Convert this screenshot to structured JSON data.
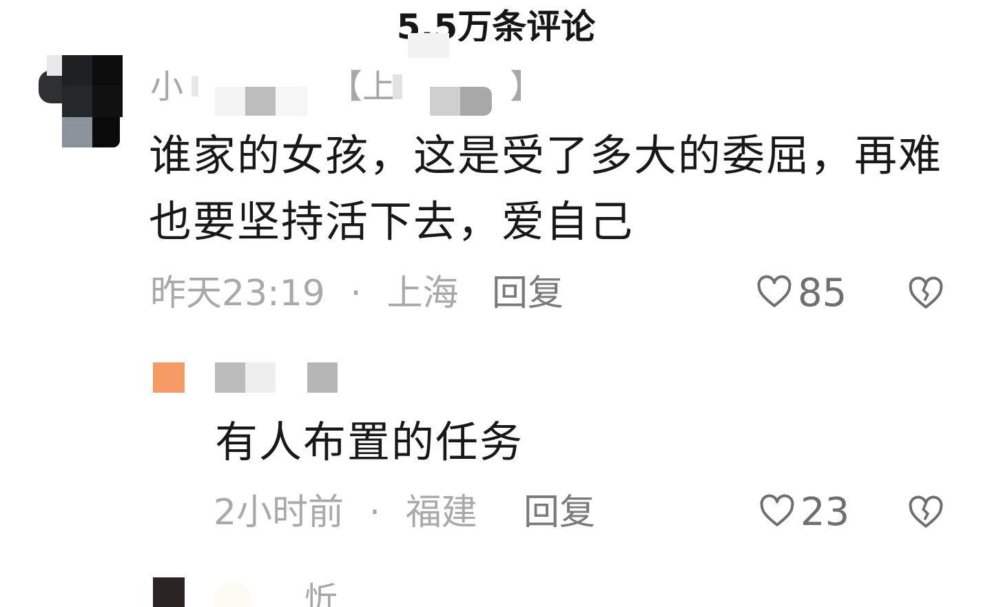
{
  "header": {
    "title": "5.5万条评论"
  },
  "comments": [
    {
      "username": "小",
      "location_tag": "【上",
      "tag_close": "】",
      "text": "谁家的女孩，这是受了多大的委屈，再难也要坚持活下去，爱自己",
      "time": "昨天23:19",
      "separator": "·",
      "location": "上海",
      "reply_label": "回复",
      "likes": "85"
    }
  ],
  "replies": [
    {
      "text": "有人布置的任务",
      "time": "2小时前",
      "separator": "·",
      "location": "福建",
      "reply_label": "回复",
      "likes": "23"
    }
  ],
  "next_comment": {
    "username_partial": "忻"
  },
  "icons": {
    "like": "heart-outline-icon",
    "dislike": "broken-heart-icon"
  }
}
